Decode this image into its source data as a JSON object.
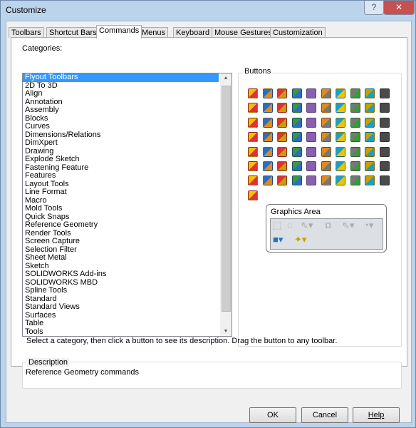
{
  "window": {
    "title": "Customize",
    "help_label": "?",
    "close_label": "✕"
  },
  "tabs": [
    {
      "label": "Toolbars"
    },
    {
      "label": "Shortcut Bars"
    },
    {
      "label": "Commands",
      "selected": true
    },
    {
      "label": "Menus"
    },
    {
      "label": "Keyboard"
    },
    {
      "label": "Mouse Gestures"
    },
    {
      "label": "Customization"
    }
  ],
  "categories": {
    "label": "Categories:",
    "selected": "Flyout Toolbars",
    "items": [
      "Flyout Toolbars",
      "2D To 3D",
      "Align",
      "Annotation",
      "Assembly",
      "Blocks",
      "Curves",
      "Dimensions/Relations",
      "DimXpert",
      "Drawing",
      "Explode Sketch",
      "Fastening Feature",
      "Features",
      "Layout Tools",
      "Line Format",
      "Macro",
      "Mold Tools",
      "Quick Snaps",
      "Reference Geometry",
      "Render Tools",
      "Screen Capture",
      "Selection Filter",
      "Sheet Metal",
      "Sketch",
      "SOLIDWORKS Add-ins",
      "SOLIDWORKS MBD",
      "Spline Tools",
      "Standard",
      "Standard Views",
      "Surfaces",
      "Table",
      "Tools"
    ]
  },
  "buttons": {
    "label": "Buttons",
    "icon_count": 71,
    "icon_colors": [
      "#f2c200",
      "#2a6fbf",
      "#d33",
      "#3a9a3a",
      "#8a5fb0",
      "#e08a1e",
      "#1aa0c8",
      "#777",
      "#c8a000",
      "#4a4a4a"
    ]
  },
  "graphics_area": {
    "title": "Graphics Area",
    "icons": [
      "box-select-icon",
      "lasso-select-icon",
      "selection-filter-icon",
      "magnified-select-icon",
      "select-icon",
      "select-other-icon",
      "view-orientation-icon",
      "hide-show-icon"
    ]
  },
  "hint": "Select a category, then click a button to see its description. Drag the button to any toolbar.",
  "description": {
    "label": "Description",
    "text": "Reference Geometry commands"
  },
  "footer": {
    "ok": "OK",
    "cancel": "Cancel",
    "help": "Help"
  }
}
